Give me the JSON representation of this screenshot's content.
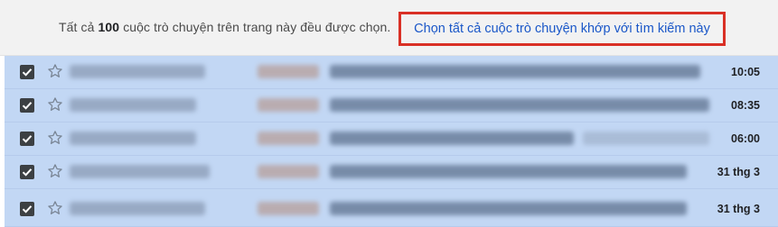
{
  "banner": {
    "prefix": "Tất cả",
    "count": "100",
    "suffix": "cuộc trò chuyện trên trang này đều được chọn.",
    "select_all_link": "Chọn tất cả cuộc trò chuyện khớp với tìm kiếm này"
  },
  "rows": [
    {
      "date": "10:05",
      "selected": true,
      "starred": false
    },
    {
      "date": "08:35",
      "selected": true,
      "starred": false
    },
    {
      "date": "06:00",
      "selected": true,
      "starred": false
    },
    {
      "date": "31 thg 3",
      "selected": true,
      "starred": false
    },
    {
      "date": "31 thg 3",
      "selected": true,
      "starred": false
    }
  ],
  "icons": {
    "checkbox": "checkbox-checked-icon",
    "star": "star-outline-icon"
  },
  "colors": {
    "selected_row": "#c2d7f4",
    "link": "#1a57c8",
    "highlight_box": "#d93025",
    "banner_bg": "#f2f2f2"
  }
}
